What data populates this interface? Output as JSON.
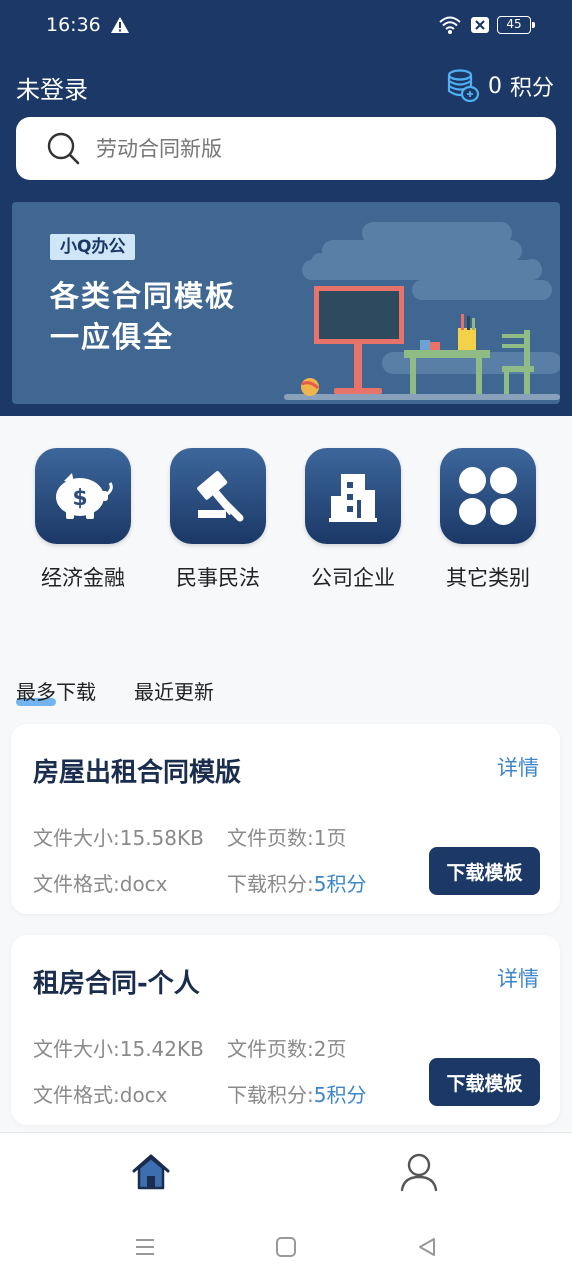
{
  "status_bar": {
    "time": "16:36",
    "battery": "45",
    "icons": [
      "warning-icon",
      "wifi-icon",
      "sim-icon",
      "battery-icon"
    ]
  },
  "header": {
    "login_status": "未登录",
    "points_value": "0",
    "points_unit": "积分"
  },
  "search": {
    "placeholder": "劳动合同新版"
  },
  "banner": {
    "tag": "小Q办公",
    "line1": "各类合同模板",
    "line2": "一应俱全"
  },
  "categories": [
    {
      "label": "经济金融",
      "icon": "piggy-bank-icon"
    },
    {
      "label": "民事民法",
      "icon": "gavel-icon"
    },
    {
      "label": "公司企业",
      "icon": "building-icon"
    },
    {
      "label": "其它类别",
      "icon": "grid-icon"
    }
  ],
  "tabs": [
    {
      "label": "最多下载",
      "active": true
    },
    {
      "label": "最近更新",
      "active": false
    }
  ],
  "cards": [
    {
      "title": "房屋出租合同模版",
      "detail": "详情",
      "size_label": "文件大小:",
      "size_value": "15.58KB",
      "pages_label": "文件页数:",
      "pages_value": "1页",
      "format_label": "文件格式:",
      "format_value": "docx",
      "points_label": "下载积分:",
      "points_value": "5积分",
      "button": "下载模板"
    },
    {
      "title": "租房合同-个人",
      "detail": "详情",
      "size_label": "文件大小:",
      "size_value": "15.42KB",
      "pages_label": "文件页数:",
      "pages_value": "2页",
      "format_label": "文件格式:",
      "format_value": "docx",
      "points_label": "下载积分:",
      "points_value": "5积分",
      "button": "下载模板"
    }
  ],
  "bottom_nav": {
    "items": [
      "home-icon",
      "user-icon"
    ]
  },
  "colors": {
    "primary": "#1b3866",
    "accent": "#3c86c9",
    "banner": "#3f6792"
  }
}
